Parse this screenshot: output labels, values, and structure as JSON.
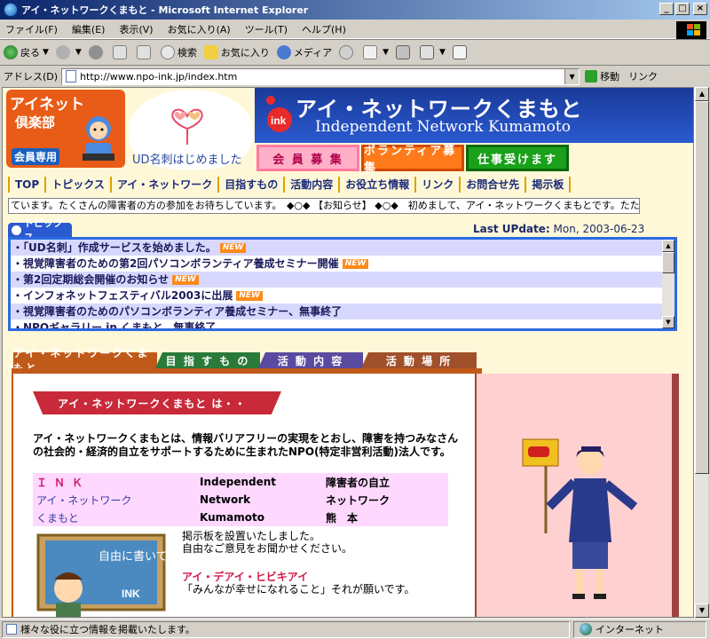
{
  "window": {
    "title": "アイ・ネットワークくまもと - Microsoft Internet Explorer",
    "minimize": "_",
    "maximize": "□",
    "close": "×"
  },
  "menu": [
    "ファイル(F)",
    "編集(E)",
    "表示(V)",
    "お気に入り(A)",
    "ツール(T)",
    "ヘルプ(H)"
  ],
  "toolbar": {
    "back": "戻る",
    "search": "検索",
    "favorites": "お気に入り",
    "media": "メディア"
  },
  "address": {
    "label": "アドレス(D)",
    "url": "http://www.npo-ink.jp/index.htm",
    "go": "移動",
    "links": "リンク"
  },
  "header": {
    "club_title": "アイネット",
    "club_sub": "倶楽部",
    "club_members": "会員専用",
    "cloud_label": "UD名刺はじめました",
    "site_title": "アイ・ネットワークくまもと",
    "site_subtitle": "Independent Network Kumamoto",
    "btn_member": "会 員 募 集",
    "btn_volunteer": "ボランティア募集",
    "btn_job": "仕事受けます"
  },
  "nav": [
    "TOP",
    "トピックス",
    "アイ・ネットワーク",
    "目指すもの",
    "活動内容",
    "お役立ち情報",
    "リンク",
    "お問合せ先",
    "掲示板"
  ],
  "ticker": "ています。たくさんの障害者の方の参加をお待ちしています。　◆○◆ 【お知らせ】 ◆○◆　初めまして、アイ・ネットワークくまもとです。たた",
  "topics": {
    "tab_label": "トピックス",
    "last_update_label": "Last UPdate:",
    "last_update_value": "Mon, 2003-06-23",
    "new_label": "NEW",
    "items": [
      {
        "text": "・「UD名刺」作成サービスを始めました。",
        "new": true
      },
      {
        "text": "・視覚障害者のための第2回パソコンボランティア養成セミナー開催",
        "new": true
      },
      {
        "text": "・第2回定期総会開催のお知らせ",
        "new": true
      },
      {
        "text": "・インフォネットフェスティバル2003に出展",
        "new": true
      },
      {
        "text": "・視覚障害者のためのパソコンボランティア養成セミナー、無事終了",
        "new": false
      },
      {
        "text": "・NPOギャラリー in くまもと、無事終了",
        "new": false
      }
    ]
  },
  "tabs": [
    "アイ・ネットワークくまもと",
    "目 指 す も の",
    "活 動 内 容",
    "活 動 場 所"
  ],
  "content": {
    "banner": "アイ・ネットワークくまもと は・・",
    "intro": "アイ・ネットワークくまもとは、情報バリアフリーの実現をとおし、障害を持つみなさんの社会的・経済的自立をサポートするために生まれたNPO(特定非営利活動)法人です。",
    "ink_rows": [
      [
        "ＩＮＫ",
        "Independent",
        "障害者の自立"
      ],
      [
        "アイ・ネットワーク",
        "Network",
        "ネットワーク"
      ],
      [
        "くまもと",
        "Kumamoto",
        "熊　本"
      ]
    ],
    "chalkboard_text": "自由に書いてね。",
    "chalkboard_ink": "INK",
    "bbs_line1": "掲示板を設置いたしました。",
    "bbs_line2": "自由なご意見をお聞かせください。",
    "motto_title": "アイ・デアイ・ヒビキアイ",
    "motto_text": "「みんなが幸せになれること」それが願いです。"
  },
  "status": {
    "text": "様々な役に立つ情報を掲載いたします。",
    "zone": "インターネット"
  },
  "colors": {
    "title_bar": "#0a246a",
    "header_blue": "#1a3a9a",
    "topics_border": "#2a6ae0",
    "new_badge": "#ff8a1a",
    "banner_red": "#c82a3a"
  }
}
